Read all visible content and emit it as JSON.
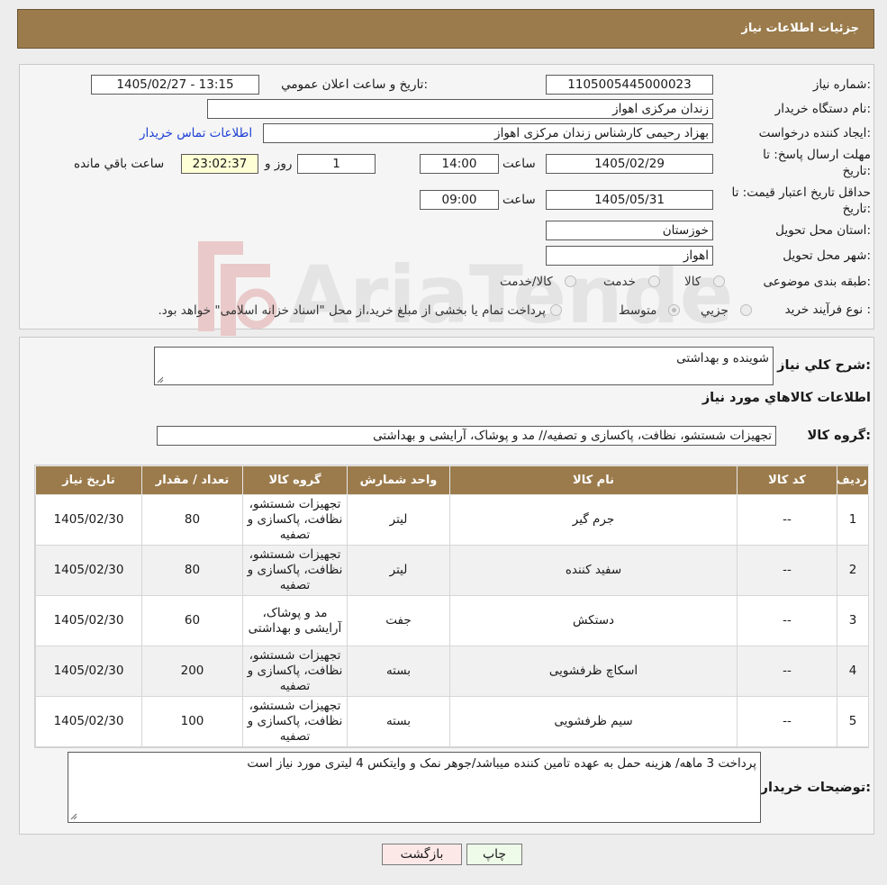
{
  "header": {
    "title": "جزئیات اطلاعات نیاز"
  },
  "form": {
    "need_number_label": "شماره نیاز:",
    "need_number": "1105005445000023",
    "announce_label": "تاریخ و ساعت اعلان عمومي:",
    "announce_value": "1405/02/27 - 13:15",
    "buyer_org_label": "نام دستگاه خريدار:",
    "buyer_org": "زندان مرکزی اهواز",
    "creator_label": "ايجاد کننده درخواست:",
    "creator": "بهزاد رحیمی کارشناس زندان مرکزی اهواز",
    "contact_link": "اطلاعات تماس خريدار",
    "deadline_label_line1": "مهلت ارسال پاسخ: تا",
    "deadline_label_line2": "تاريخ:",
    "deadline_date": "1405/02/29",
    "hour_label": "ساعت",
    "deadline_time": "14:00",
    "days_value": "1",
    "days_label": "روز و",
    "remaining_time": "23:02:37",
    "remaining_label": "ساعت باقي مانده",
    "validity_label_line1": "حداقل تاريخ اعتبار قيمت: تا",
    "validity_label_line2": "تاريخ:",
    "validity_date": "1405/05/31",
    "validity_time": "09:00",
    "province_label": "استان محل تحويل:",
    "province": "خوزستان",
    "city_label": "شهر محل تحويل:",
    "city": "اهواز",
    "category_label": "طبقه بندی موضوعی:",
    "category_options": [
      "کالا",
      "خدمت",
      "کالا/خدمت"
    ],
    "process_label": "نوع فرآيند خريد :",
    "process_options": [
      "جزيي",
      "متوسط"
    ],
    "process_note": "پرداخت تمام يا بخشی از مبلغ خريد،از محل \"اسناد خزانه اسلامی\" خواهد بود."
  },
  "watermark": {
    "text": "AriaTender.neT"
  },
  "details": {
    "summary_label": "شرح کلي نياز:",
    "summary": "شوینده و بهداشتی",
    "goods_info_title": "اطلاعات کالاهاي مورد نياز",
    "goods_group_label": "گروه کالا:",
    "goods_group": "تجهیزات شستشو، نظافت، پاکسازی و تصفیه// مد و پوشاک، آرایشی و بهداشتی"
  },
  "table": {
    "headers": [
      "رديف",
      "کد کالا",
      "نام کالا",
      "واحد شمارش",
      "گروه کالا",
      "تعداد / مقدار",
      "تاريخ نياز"
    ],
    "rows": [
      [
        "1",
        "--",
        "جرم گیر",
        "لیتر",
        "تجهیزات شستشو، نظافت، پاکسازی و تصفیه",
        "80",
        "1405/02/30"
      ],
      [
        "2",
        "--",
        "سفید کننده",
        "لیتر",
        "تجهیزات شستشو، نظافت، پاکسازی و تصفیه",
        "80",
        "1405/02/30"
      ],
      [
        "3",
        "--",
        "دستکش",
        "جفت",
        "مد و پوشاک، آرایشی و بهداشتی",
        "60",
        "1405/02/30"
      ],
      [
        "4",
        "--",
        "اسکاچ ظرفشویی",
        "بسته",
        "تجهیزات شستشو، نظافت، پاکسازی و تصفیه",
        "200",
        "1405/02/30"
      ],
      [
        "5",
        "--",
        "سیم ظرفشویی",
        "بسته",
        "تجهیزات شستشو، نظافت، پاکسازی و تصفیه",
        "100",
        "1405/02/30"
      ]
    ]
  },
  "notes": {
    "label": "توضيحات خريدار:",
    "text": "پرداخت 3 ماهه/ هزینه حمل به عهده تامین کننده میباشد/جوهر نمک و وایتکس 4 لیتری مورد نیاز است"
  },
  "buttons": {
    "print": "چاپ",
    "back": "بازگشت"
  },
  "colors": {
    "header_bg": "#9b7b4c",
    "link": "#1c3fd6",
    "back_btn": "#fde8e8",
    "print_btn": "#eefbe8"
  }
}
